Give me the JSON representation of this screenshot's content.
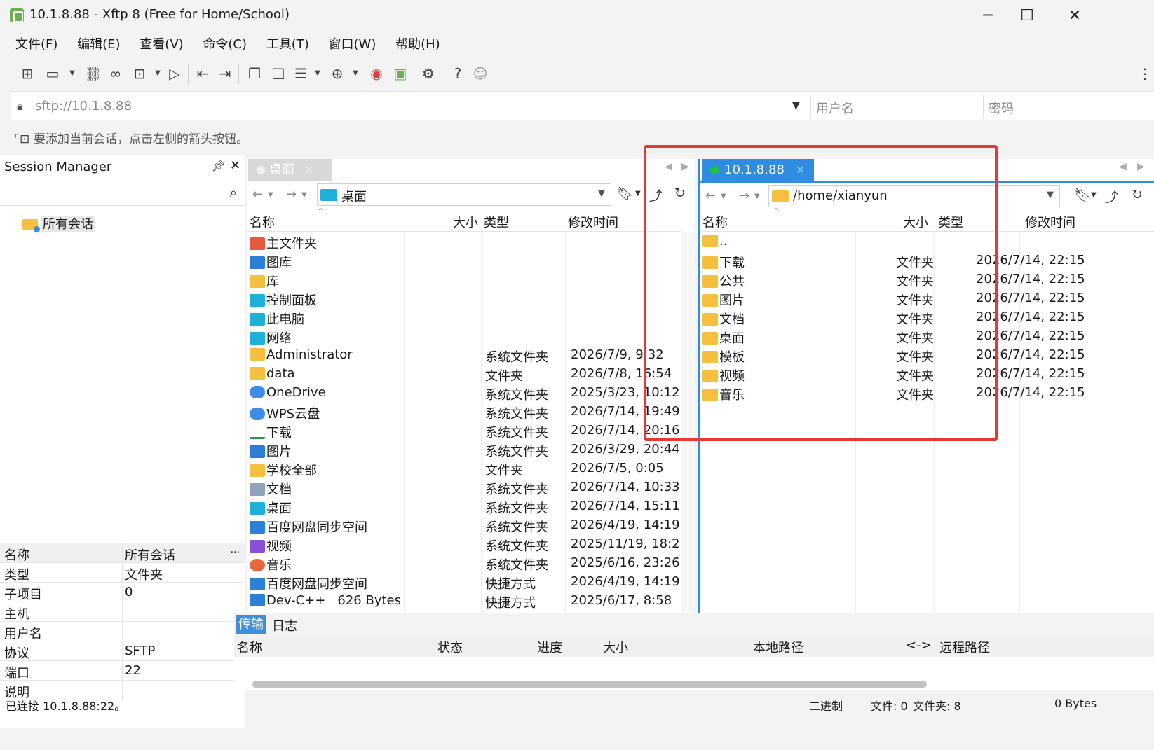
{
  "window": {
    "title": "10.1.8.88 - Xftp 8 (Free for Home/School)",
    "minimize": "─",
    "maximize": "☐",
    "close": "✕"
  },
  "menu": [
    "文件(F)",
    "编辑(E)",
    "查看(V)",
    "命令(C)",
    "工具(T)",
    "窗口(W)",
    "帮助(H)"
  ],
  "address": {
    "url": "sftp://10.1.8.88",
    "username_placeholder": "用户名",
    "password_placeholder": "密码"
  },
  "hint": "要添加当前会话，点击左侧的箭头按钮。",
  "session_manager": {
    "title": "Session Manager",
    "tree_item": "所有会话",
    "properties": [
      {
        "key": "名称",
        "value": "所有会话"
      },
      {
        "key": "类型",
        "value": "文件夹"
      },
      {
        "key": "子项目",
        "value": "0"
      },
      {
        "key": "主机",
        "value": ""
      },
      {
        "key": "用户名",
        "value": ""
      },
      {
        "key": "协议",
        "value": "SFTP"
      },
      {
        "key": "端口",
        "value": "22"
      },
      {
        "key": "说明",
        "value": ""
      }
    ]
  },
  "local": {
    "tab": "桌面",
    "path": "桌面",
    "columns": {
      "name": "名称",
      "size": "大小",
      "type": "类型",
      "modified": "修改时间"
    },
    "rows": [
      {
        "icon": "home-icon",
        "name": "主文件夹",
        "size": "",
        "type": "",
        "modified": ""
      },
      {
        "icon": "pictures-icon",
        "name": "图库",
        "size": "",
        "type": "",
        "modified": ""
      },
      {
        "icon": "folder-icon",
        "name": "库",
        "size": "",
        "type": "",
        "modified": ""
      },
      {
        "icon": "control-panel-icon",
        "name": "控制面板",
        "size": "",
        "type": "",
        "modified": ""
      },
      {
        "icon": "computer-icon",
        "name": "此电脑",
        "size": "",
        "type": "",
        "modified": ""
      },
      {
        "icon": "network-icon",
        "name": "网络",
        "size": "",
        "type": "",
        "modified": ""
      },
      {
        "icon": "folder-icon",
        "name": "Administrator",
        "size": "",
        "type": "系统文件夹",
        "modified": "2026/7/9, 9:32"
      },
      {
        "icon": "folder-icon",
        "name": "data",
        "size": "",
        "type": "文件夹",
        "modified": "2026/7/8, 16:54"
      },
      {
        "icon": "cloud-icon",
        "name": "OneDrive",
        "size": "",
        "type": "系统文件夹",
        "modified": "2025/3/23, 10:12"
      },
      {
        "icon": "cloud-icon",
        "name": "WPS云盘",
        "size": "",
        "type": "系统文件夹",
        "modified": "2026/7/14, 19:49"
      },
      {
        "icon": "download-icon",
        "name": "下载",
        "size": "",
        "type": "系统文件夹",
        "modified": "2026/7/14, 20:16"
      },
      {
        "icon": "pictures-icon",
        "name": "图片",
        "size": "",
        "type": "系统文件夹",
        "modified": "2026/3/29, 20:44"
      },
      {
        "icon": "folder-icon",
        "name": "学校全部",
        "size": "",
        "type": "文件夹",
        "modified": "2026/7/5, 0:05"
      },
      {
        "icon": "document-icon",
        "name": "文档",
        "size": "",
        "type": "系统文件夹",
        "modified": "2026/7/14, 10:33"
      },
      {
        "icon": "desktop-icon",
        "name": "桌面",
        "size": "",
        "type": "系统文件夹",
        "modified": "2026/7/14, 15:11"
      },
      {
        "icon": "sync-icon",
        "name": "百度网盘同步空间",
        "size": "",
        "type": "系统文件夹",
        "modified": "2026/4/19, 14:19"
      },
      {
        "icon": "video-icon",
        "name": "视频",
        "size": "",
        "type": "系统文件夹",
        "modified": "2025/11/19, 18:2"
      },
      {
        "icon": "music-icon",
        "name": "音乐",
        "size": "",
        "type": "系统文件夹",
        "modified": "2025/6/16, 23:26"
      },
      {
        "icon": "shortcut-icon",
        "name": "百度网盘同步空间",
        "size": "",
        "type": "快捷方式",
        "modified": "2026/4/19, 14:19"
      },
      {
        "icon": "app-icon",
        "name": "Dev-C++",
        "size": "626 Bytes",
        "type": "快捷方式",
        "modified": "2025/6/17, 8:58"
      }
    ]
  },
  "remote": {
    "tab": "10.1.8.88",
    "path": "/home/xianyun",
    "columns": {
      "name": "名称",
      "size": "大小",
      "type": "类型",
      "modified": "修改时间"
    },
    "rows": [
      {
        "name": "..",
        "type": "",
        "modified": ""
      },
      {
        "name": "下载",
        "type": "文件夹",
        "modified": "2026/7/14, 22:15"
      },
      {
        "name": "公共",
        "type": "文件夹",
        "modified": "2026/7/14, 22:15"
      },
      {
        "name": "图片",
        "type": "文件夹",
        "modified": "2026/7/14, 22:15"
      },
      {
        "name": "文档",
        "type": "文件夹",
        "modified": "2026/7/14, 22:15"
      },
      {
        "name": "桌面",
        "type": "文件夹",
        "modified": "2026/7/14, 22:15"
      },
      {
        "name": "模板",
        "type": "文件夹",
        "modified": "2026/7/14, 22:15"
      },
      {
        "name": "视频",
        "type": "文件夹",
        "modified": "2026/7/14, 22:15"
      },
      {
        "name": "音乐",
        "type": "文件夹",
        "modified": "2026/7/14, 22:15"
      }
    ]
  },
  "transfer": {
    "tabs": [
      "传输",
      "日志"
    ],
    "columns": [
      "名称",
      "状态",
      "进度",
      "大小",
      "本地路径",
      "<->",
      "远程路径"
    ]
  },
  "status": {
    "connected": "已连接 10.1.8.88:22。",
    "mode": "二进制",
    "files": "文件: 0",
    "folders": "文件夹: 8",
    "bytes": "0 Bytes"
  },
  "colors": {
    "accent": "#2f8ce0",
    "highlight_box": "#e53935",
    "folder": "#f5c040",
    "online": "#1fc23a"
  }
}
